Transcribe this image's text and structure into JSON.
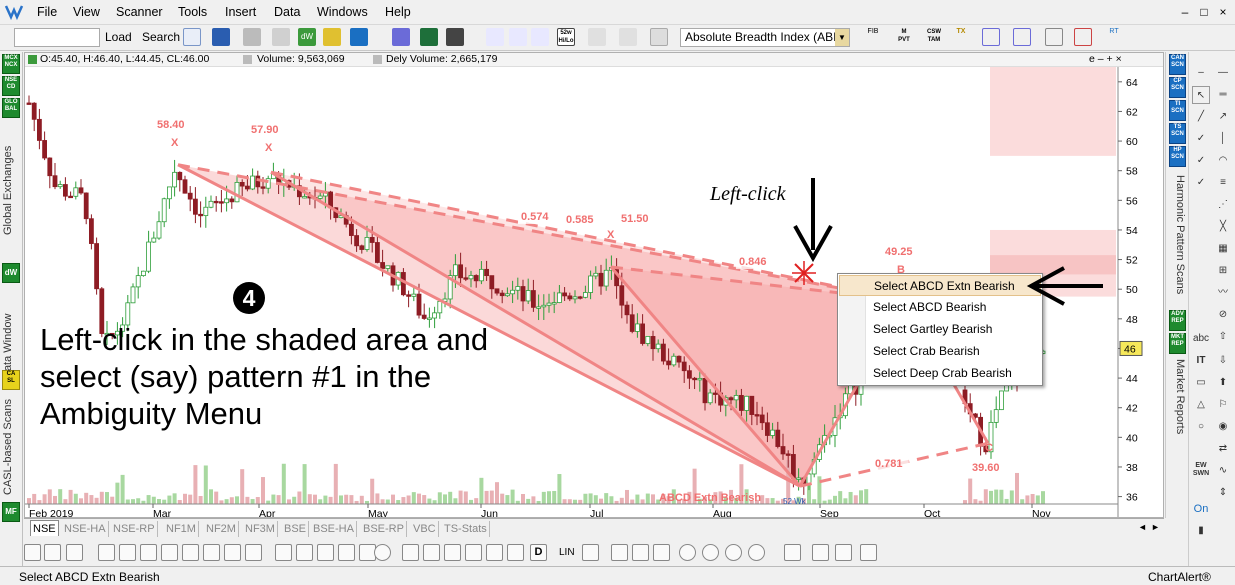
{
  "menu": {
    "items": [
      "File",
      "View",
      "Scanner",
      "Tools",
      "Insert",
      "Data",
      "Windows",
      "Help"
    ],
    "window_controls": [
      "–",
      "□",
      "×"
    ]
  },
  "toolbar": {
    "load_label": "Load",
    "search_label": "Search",
    "indicator_select": "Absolute Breadth Index (ABI",
    "button_labels": [
      "52w Hi/Lo",
      "M PVT",
      "CSW TAM",
      "TX"
    ]
  },
  "left_sidebar": {
    "badges": [
      "MCX NCX",
      "NSE CD",
      "GLO BAL",
      "dW",
      "CA SL",
      "MF"
    ],
    "labels": [
      "Global Exchanges",
      "Data Window",
      "CASL-based Scans"
    ]
  },
  "info_bar": {
    "ohlc": "O:45.40, H:46.40, L:44.45, CL:46.00",
    "volume": "Volume: 9,563,069",
    "dely_volume": "Dely Volume: 2,665,179",
    "window_controls": "e – + ×"
  },
  "chart_data": {
    "type": "candlestick",
    "ylim": [
      35.5,
      65
    ],
    "y_ticks": [
      36,
      38,
      40,
      42,
      44,
      46,
      48,
      50,
      52,
      54,
      56,
      58,
      60,
      62,
      64
    ],
    "x_labels": [
      "Feb 2019",
      "Mar",
      "Apr",
      "May",
      "Jun",
      "Jul",
      "Aug",
      "Sep",
      "Oct",
      "Nov"
    ],
    "last_price": "46",
    "pattern_points": [
      {
        "label": "X",
        "value": "58.40"
      },
      {
        "label": "X",
        "value": "57.90"
      },
      {
        "label": "X",
        "value": "51.50"
      },
      {
        "label": "B",
        "value": "49.25"
      },
      {
        "label": "C",
        "value": "39.60"
      }
    ],
    "ratios": [
      "0.574",
      "0.585",
      "0.846",
      "0.781"
    ],
    "overlay_label": "ABCD Extn Bearish",
    "marker_label": "52 Wk"
  },
  "context_menu": {
    "items": [
      "Select ABCD Extn Bearish",
      "Select ABCD Bearish",
      "Select Gartley Bearish",
      "Select Crab Bearish",
      "Select Deep Crab Bearish"
    ],
    "selected_index": 0
  },
  "annotation": {
    "step_number": "4",
    "instruction": "Left-click in the shaded area and select (say) pattern #1 in the Ambiguity Menu",
    "left_click_label": "Left-click"
  },
  "tabs": {
    "items": [
      "NSE",
      "NSE-HA",
      "NSE-RP",
      "NF1M",
      "NF2M",
      "NF3M",
      "BSE",
      "BSE-HA",
      "BSE-RP",
      "VBC",
      "TS-Stats"
    ],
    "active_index": 0
  },
  "bottom_toolbar": {
    "lin_label": "LIN"
  },
  "right_panel": {
    "badges": [
      "CAN SCN",
      "CP SCN",
      "TI SCN",
      "TS SCN",
      "HP SCN",
      "ADV REP",
      "MKT REP"
    ],
    "labels": [
      "Harmonic Pattern Scans",
      "Market Reports"
    ],
    "tool_labels": [
      "abc",
      "IT",
      "EW SWN",
      "On"
    ]
  },
  "status": {
    "left": "Select ABCD Extn Bearish",
    "right": "ChartAlert®"
  }
}
